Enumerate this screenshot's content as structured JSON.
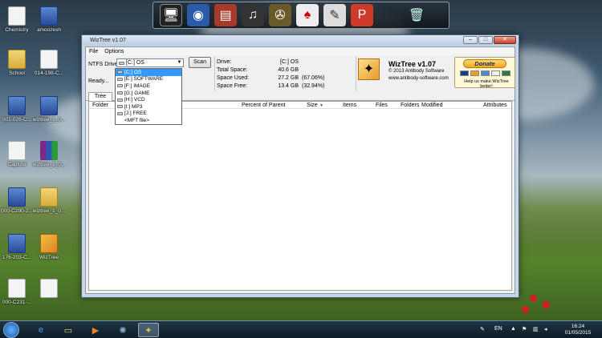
{
  "desktop": {
    "icons": [
      {
        "label": "Chemistry",
        "glyph": "doc"
      },
      {
        "label": "amoozesh",
        "glyph": "blue"
      },
      {
        "label": "School",
        "glyph": "folder"
      },
      {
        "label": "014-198-C...",
        "glyph": "doc"
      },
      {
        "label": "001-026-C...",
        "glyph": "blue"
      },
      {
        "label": "wiztree_1_0...",
        "glyph": "blue"
      },
      {
        "label": "Capture",
        "glyph": "doc"
      },
      {
        "label": "wiztree_1_0...",
        "glyph": "rar"
      },
      {
        "label": "000-C290-2...",
        "glyph": "blue"
      },
      {
        "label": "wiztree_1_0...",
        "glyph": "folder"
      },
      {
        "label": "176-203-C...",
        "glyph": "blue"
      },
      {
        "label": "WizTree",
        "glyph": "wiz"
      },
      {
        "label": "000-C231-...",
        "glyph": "doc"
      },
      {
        "label": "",
        "glyph": "doc"
      }
    ]
  },
  "window": {
    "title": "WizTree v1.07",
    "buttons": {
      "minimize": "–",
      "maximize": "□",
      "close": "✕"
    },
    "menu": [
      "File",
      "Options"
    ],
    "ntfs_label": "NTFS Drive:",
    "selected_drive": "[C:] OS",
    "scan_label": "Scan",
    "status": "Ready...",
    "drive_info": {
      "drive_label": "Drive:",
      "drive_value": "[C:]  OS",
      "rows": [
        {
          "key": "Total Space:",
          "value": "40.6 GB",
          "pct": ""
        },
        {
          "key": "Space Used:",
          "value": "27.2 GB",
          "pct": "(67.06%)"
        },
        {
          "key": "Space Free:",
          "value": "13.4 GB",
          "pct": "(32.94%)"
        }
      ]
    },
    "logo": {
      "title": "WizTree v1.07",
      "copyright": "© 2013 Antibody Software",
      "url": "www.antibody-software.com"
    },
    "donate": {
      "button": "Donate",
      "subtext": "Help us make WizTree better!"
    },
    "tab": "Tree View",
    "columns": [
      "Folder",
      "Percent of Parent",
      "Size",
      "Items",
      "Files",
      "Folders",
      "Modified",
      "Attributes"
    ],
    "dropdown_items": [
      "[C:] OS",
      "[E:] SOFTWARE",
      "[F:] IMAGE",
      "[G:] GAME",
      "[H:] VCD",
      "[I:] MP3",
      "[J:] FREE",
      "<MFT file>"
    ]
  },
  "taskbar": {
    "language": "EN",
    "time": "16:24",
    "date": "01/05/2015"
  },
  "colors": {
    "selection": "#3399ff",
    "donate": "#f4a820"
  }
}
